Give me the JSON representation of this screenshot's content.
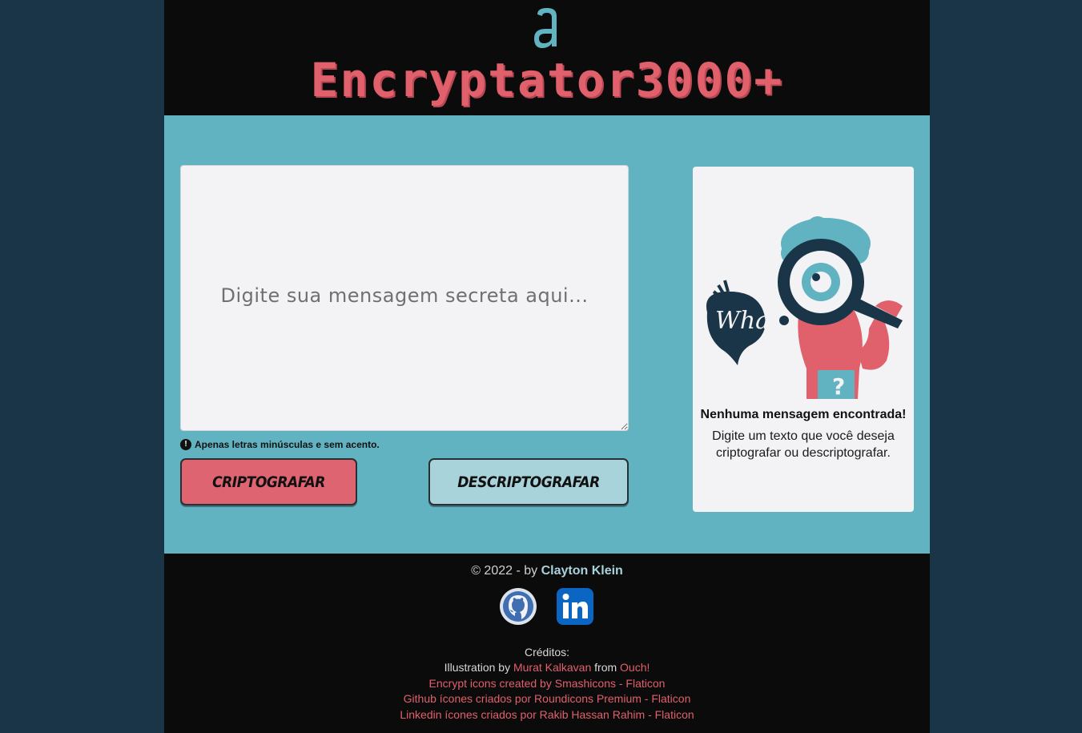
{
  "header": {
    "brand": "Encryptator3000+",
    "logo_icon": "alura-a-icon"
  },
  "main": {
    "textarea_placeholder": "Digite sua mensagem secreta aqui...",
    "hint": "Apenas letras minúsculas e sem acento.",
    "hint_icon": "!",
    "encrypt_label": "CRIPTOGRAFAR",
    "decrypt_label": "DESCRIPTOGRAFAR",
    "panel": {
      "illustration": "magnifying-glass-person-illustration",
      "title": "Nenhuma mensagem encontrada!",
      "text": "Digite um texto que você deseja criptografar ou descriptografar."
    }
  },
  "footer": {
    "copyright_prefix": "© 2022 - by ",
    "author": "Clayton Klein",
    "credits_title": "Créditos:",
    "illustration_by": "Illustration by ",
    "illustrator": "Murat Kalkavan",
    "from": " from ",
    "source": "Ouch!",
    "credit_encrypt": "Encrypt icons created by Smashicons - Flaticon",
    "credit_github": "Github ícones criados por Roundicons Premium - Flaticon",
    "credit_linkedin": "Linkedin ícones criados por Rakib Hassan Rahim - Flaticon"
  },
  "colors": {
    "background": "#1b3548",
    "header": "#0b0b0b",
    "main": "#62b3c1",
    "brand": "#e0606b",
    "encrypt_button": "#dd6470",
    "decrypt_button": "#a8d3da"
  }
}
